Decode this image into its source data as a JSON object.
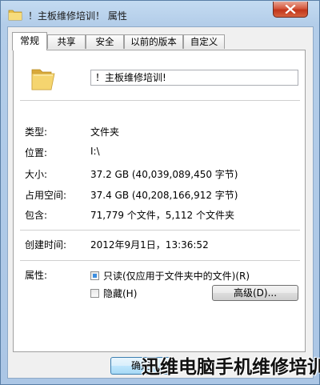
{
  "window": {
    "title": "！主板维修培训！ 属性",
    "icon": "folder-icon"
  },
  "tabs": [
    "常规",
    "共享",
    "安全",
    "以前的版本",
    "自定义"
  ],
  "active_tab": "常规",
  "general": {
    "name": "！主板维修培训!",
    "rows": [
      {
        "label": "类型:",
        "value": "文件夹"
      },
      {
        "label": "位置:",
        "value": "I:\\"
      },
      {
        "label": "大小:",
        "value": "37.2 GB (40,039,089,450 字节)"
      },
      {
        "label": "占用空间:",
        "value": "37.4 GB (40,208,166,912 字节)"
      },
      {
        "label": "包含:",
        "value": "71,779 个文件，5,112 个文件夹"
      }
    ],
    "created_label": "创建时间:",
    "created_value": "2012年9月1日，13:36:52",
    "attributes_label": "属性:",
    "readonly_label": "只读(仅应用于文件夹中的文件)(R)",
    "hidden_label": "隐藏(H)",
    "advanced_label": "高级(D)..."
  },
  "buttons": {
    "ok": "确定"
  },
  "watermark": "迅维电脑手机维修培训",
  "colors": {
    "window_frame": "#abc6e5",
    "close_button": "#c2351a",
    "folder_yellow": "#f3d46c"
  }
}
